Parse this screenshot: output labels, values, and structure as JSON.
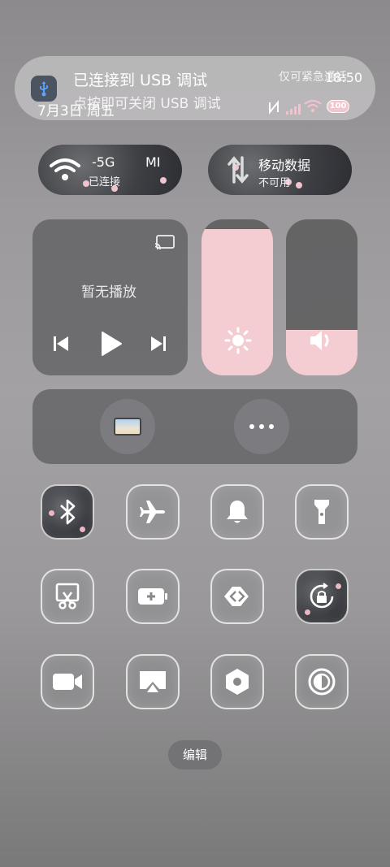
{
  "notification": {
    "title": "已连接到 USB 调试",
    "body": "点按即可关闭 USB 调试",
    "tag": "仅可紧急通话",
    "app_icon": "usb-icon"
  },
  "status": {
    "date": "7月3日 周五",
    "time": "18:50",
    "battery": "100"
  },
  "wifi": {
    "name": "-5G",
    "name_suffix": "MI",
    "status": "已连接",
    "icon": "wifi-icon"
  },
  "mobile_data": {
    "name": "移动数据",
    "status": "不可用",
    "icon": "mobile-data-icon"
  },
  "media": {
    "status": "暂无播放",
    "cast_icon": "cast-icon"
  },
  "sliders": {
    "brightness_level": 0.94,
    "volume_level": 0.29
  },
  "colors": {
    "accent_pink": "#f4cdd3",
    "tile_active_dark": "#3b3c41"
  },
  "toggles": [
    {
      "name": "bluetooth",
      "icon": "bluetooth-icon",
      "active": true
    },
    {
      "name": "airplane-mode",
      "icon": "airplane-icon",
      "active": false
    },
    {
      "name": "ring-mode",
      "icon": "bell-icon",
      "active": false
    },
    {
      "name": "flashlight",
      "icon": "flashlight-icon",
      "active": false
    },
    {
      "name": "screenshot",
      "icon": "scissors-icon",
      "active": false
    },
    {
      "name": "battery-saver",
      "icon": "battery-plus-icon",
      "active": false
    },
    {
      "name": "link-share",
      "icon": "link-share-icon",
      "active": false
    },
    {
      "name": "rotation-lock",
      "icon": "rotation-lock-icon",
      "active": true
    },
    {
      "name": "screen-record",
      "icon": "video-camera-icon",
      "active": false
    },
    {
      "name": "screen-cast",
      "icon": "cast-screen-icon",
      "active": false
    },
    {
      "name": "settings",
      "icon": "hexagon-gear-icon",
      "active": false
    },
    {
      "name": "dark-mode",
      "icon": "contrast-icon",
      "active": false
    }
  ],
  "edit_label": "编辑"
}
